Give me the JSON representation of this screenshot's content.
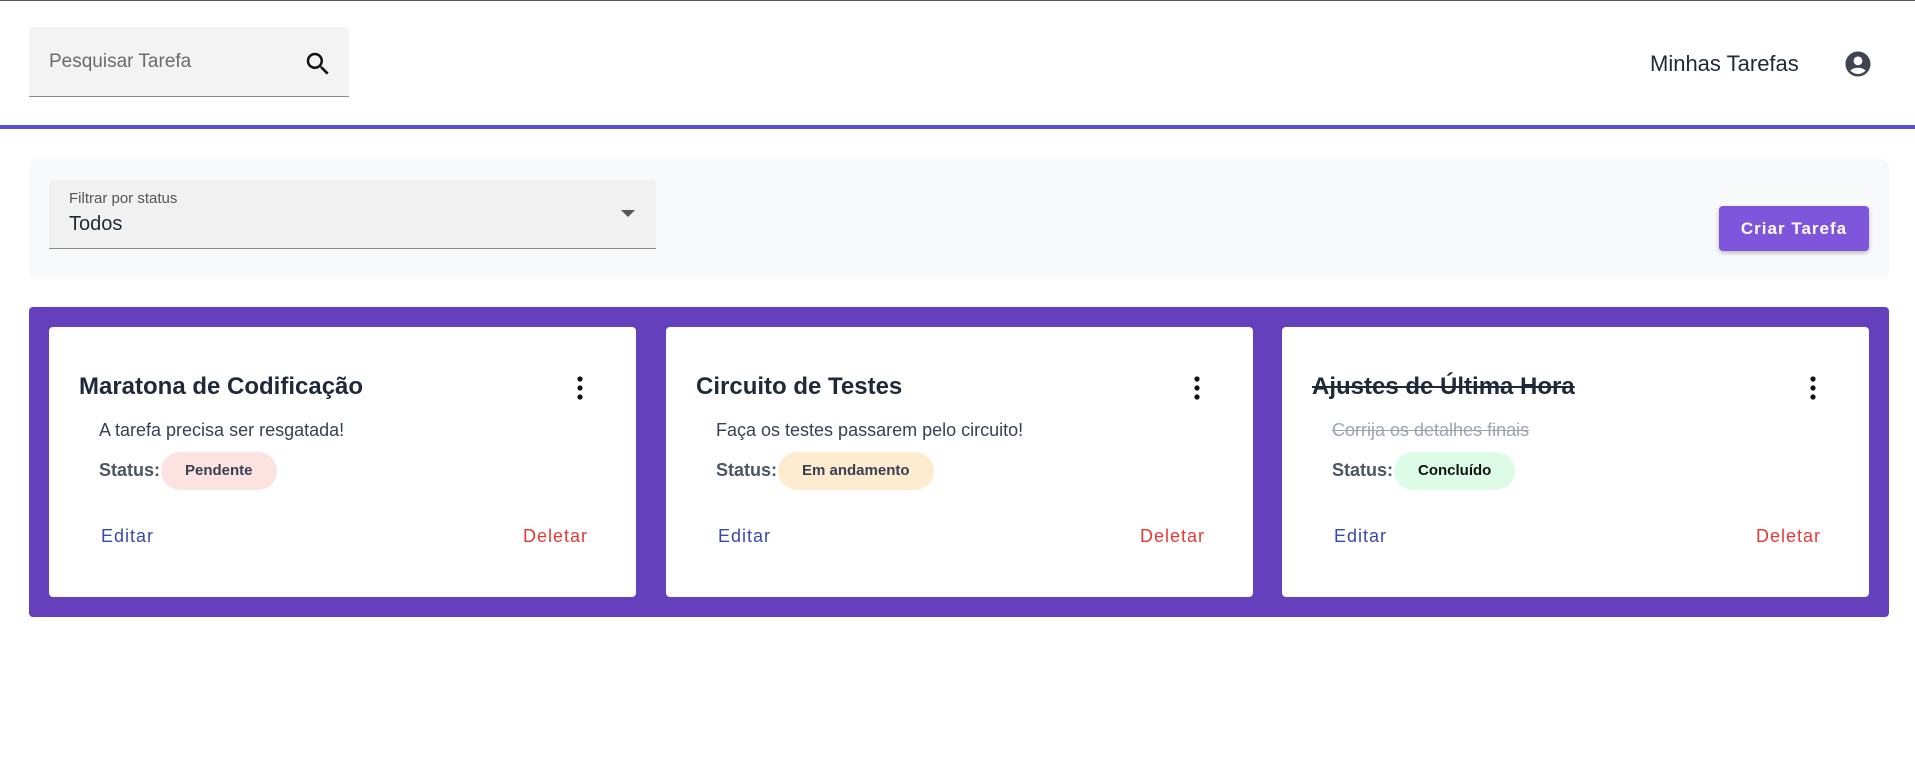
{
  "header": {
    "search_placeholder": "Pesquisar Tarefa",
    "title": "Minhas Tarefas",
    "search_icon": "search-icon",
    "account_icon": "account-circle-icon"
  },
  "filter": {
    "label": "Filtrar por status",
    "value": "Todos"
  },
  "actions": {
    "create_label": "Criar Tarefa"
  },
  "tasks": [
    {
      "title": "Maratona de Codificação",
      "description": "A tarefa precisa ser resgatada!",
      "status_label": "Status:",
      "status": "Pendente",
      "status_color": "#fde2e2",
      "completed": false,
      "edit_label": "Editar",
      "delete_label": "Deletar"
    },
    {
      "title": "Circuito de Testes",
      "description": "Faça os testes passarem pelo circuito!",
      "status_label": "Status:",
      "status": "Em andamento",
      "status_color": "#feebd0",
      "completed": false,
      "edit_label": "Editar",
      "delete_label": "Deletar"
    },
    {
      "title": "Ajustes de Última Hora",
      "description": "Corrija os detalhes finais",
      "status_label": "Status:",
      "status": "Concluído",
      "status_color": "#dcfce7",
      "completed": true,
      "edit_label": "Editar",
      "delete_label": "Deletar"
    }
  ],
  "colors": {
    "accent": "#5b4ed9",
    "create_button": "#7e55db",
    "cards_background": "#6440bd",
    "edit": "#3949ab",
    "delete": "#e53935"
  }
}
